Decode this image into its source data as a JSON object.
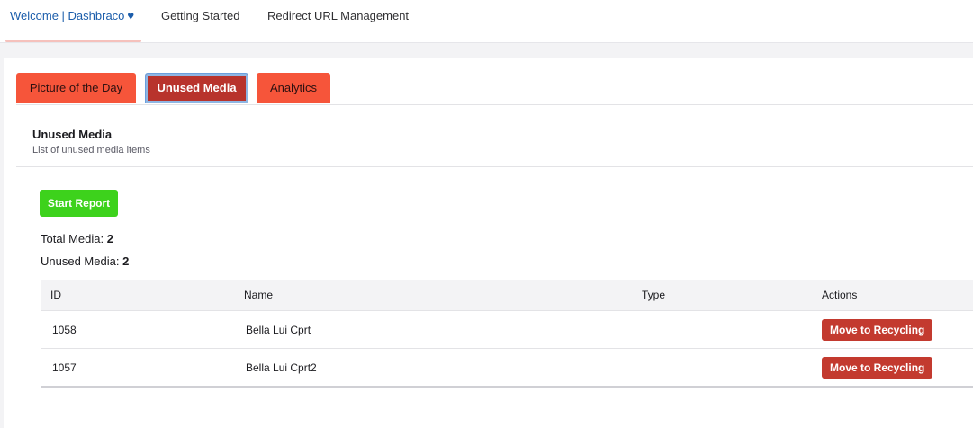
{
  "topnav": {
    "tabs": [
      {
        "label": "Welcome | Dashbraco",
        "active": true
      },
      {
        "label": "Getting Started",
        "active": false
      },
      {
        "label": "Redirect URL Management",
        "active": false
      }
    ],
    "heart_icon": "heart-icon"
  },
  "subtabs": [
    {
      "label": "Picture of the Day",
      "active": false
    },
    {
      "label": "Unused Media",
      "active": true
    },
    {
      "label": "Analytics",
      "active": false
    }
  ],
  "box": {
    "title": "Unused Media",
    "subtitle": "List of unused media items"
  },
  "actions": {
    "start_report_label": "Start Report"
  },
  "stats": {
    "total_label": "Total Media:",
    "total_value": "2",
    "unused_label": "Unused Media:",
    "unused_value": "2"
  },
  "table": {
    "headers": [
      "ID",
      "Name",
      "Type",
      "Actions"
    ],
    "rows": [
      {
        "id": "1058",
        "name": "Bella Lui Cprt",
        "type": "",
        "action": "Move to Recycling"
      },
      {
        "id": "1057",
        "name": "Bella Lui Cprt2",
        "type": "",
        "action": "Move to Recycling"
      }
    ]
  },
  "colors": {
    "tab_orange": "#f6553a",
    "tab_active": "#b8332c",
    "start_green": "#3dd21c",
    "recycle_red": "#c33a2f",
    "link_blue": "#1b5dab"
  }
}
